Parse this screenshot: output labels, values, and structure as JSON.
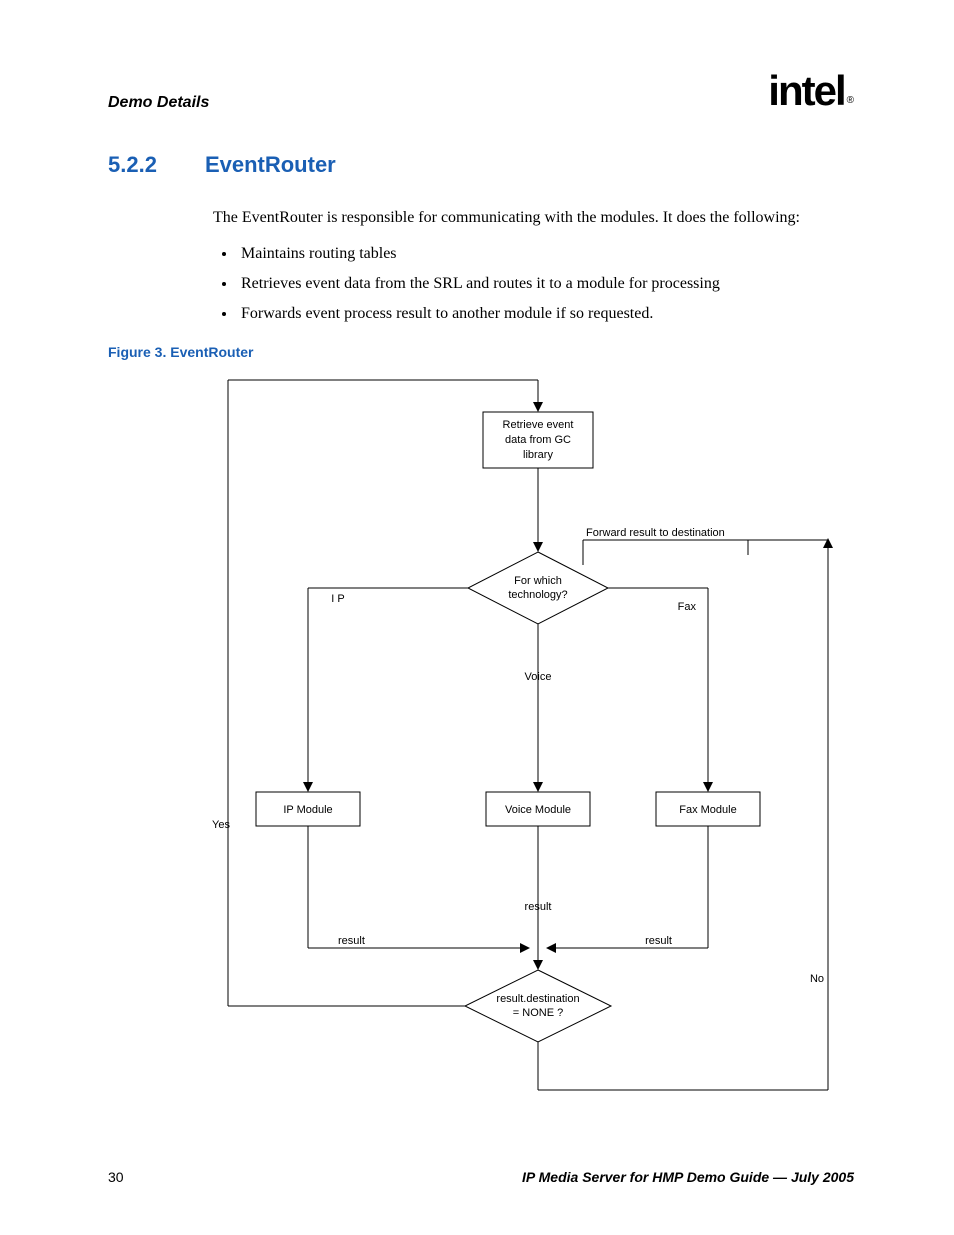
{
  "header": {
    "running_title": "Demo Details",
    "logo_text": "intel",
    "logo_registered": "®"
  },
  "section": {
    "number": "5.2.2",
    "title": "EventRouter"
  },
  "intro": "The EventRouter is responsible for communicating with the modules. It does the following:",
  "bullets": [
    "Maintains routing tables",
    "Retrieves event data from the SRL and routes it to a module for processing",
    "Forwards event process result to another module if so requested."
  ],
  "figure_caption": "Figure 3.  EventRouter",
  "diagram": {
    "retrieve_l1": "Retrieve event",
    "retrieve_l2": "data from GC",
    "retrieve_l3": "library",
    "forward_label": "Forward result to destination",
    "decision1_l1": "For which",
    "decision1_l2": "technology?",
    "branch_ip": "I P",
    "branch_voice": "Voice",
    "branch_fax": "Fax",
    "mod_ip": "IP Module",
    "mod_voice": "Voice Module",
    "mod_fax": "Fax Module",
    "result": "result",
    "decision2_l1": "result.destination",
    "decision2_l2": "= NONE ?",
    "yes": "Yes",
    "no": "No"
  },
  "footer": {
    "page_number": "30",
    "doc_title": "IP Media Server for HMP Demo Guide — July 2005"
  }
}
